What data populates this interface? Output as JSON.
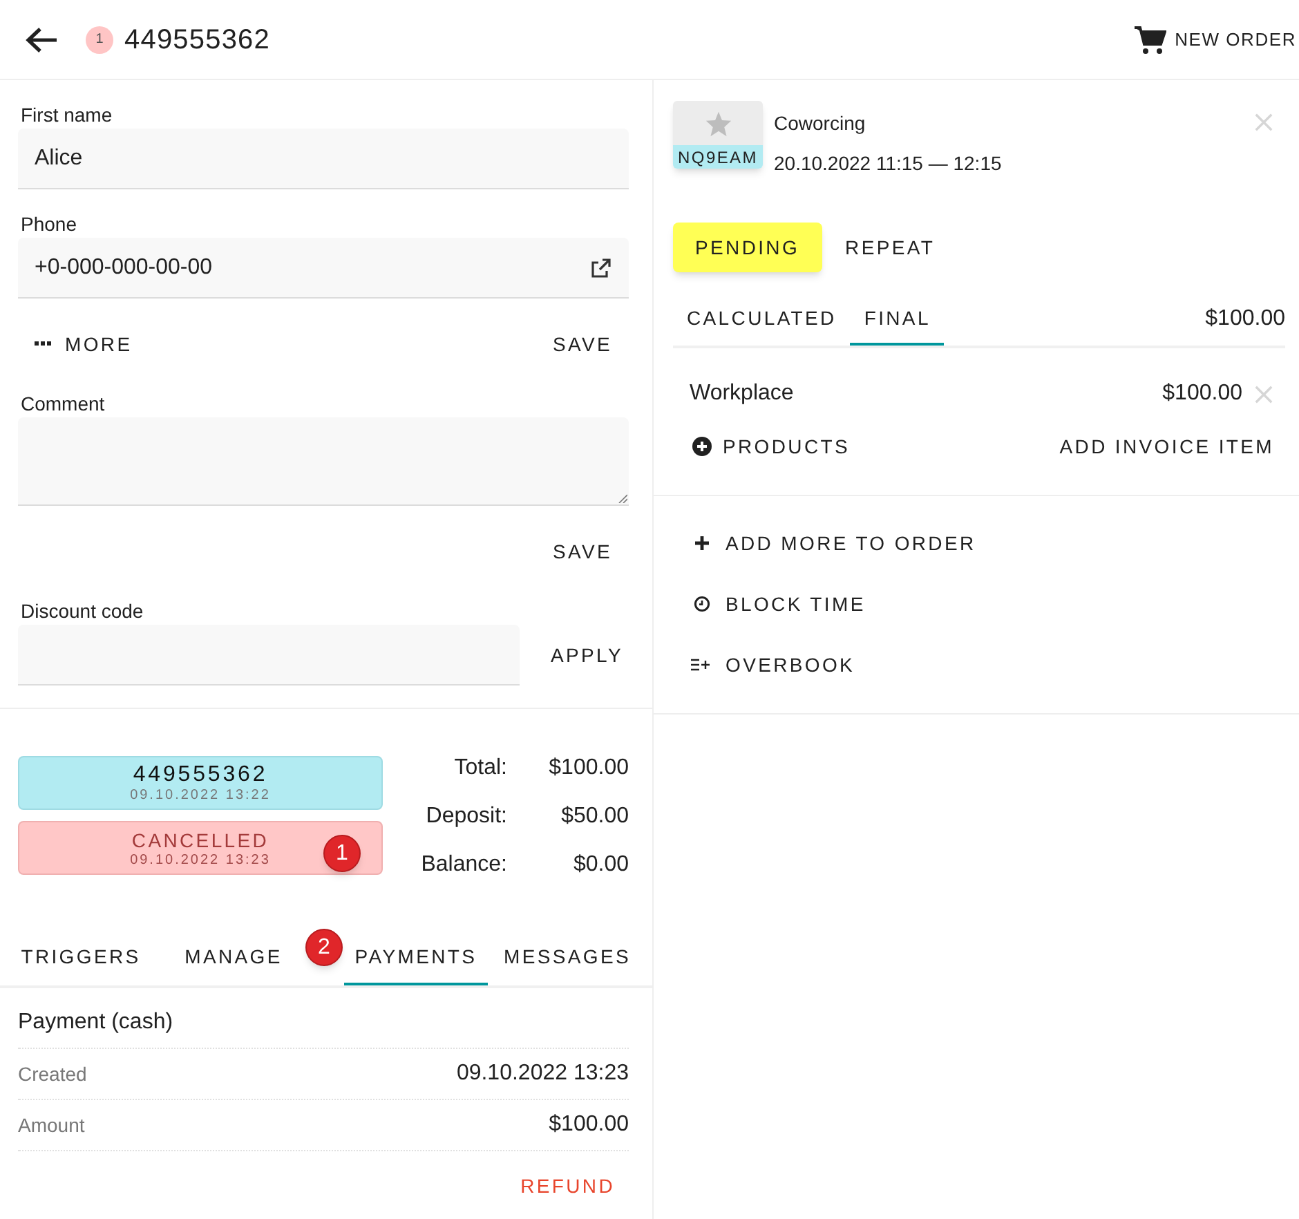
{
  "header": {
    "badge": "1",
    "title": "449555362",
    "new_order": "NEW ORDER"
  },
  "customer": {
    "first_name": {
      "label": "First name",
      "value": "Alice"
    },
    "phone": {
      "label": "Phone",
      "value": "+0-000-000-00-00"
    },
    "more": "MORE",
    "save": "SAVE"
  },
  "comment": {
    "label": "Comment",
    "save": "SAVE"
  },
  "discount": {
    "label": "Discount code",
    "apply": "APPLY"
  },
  "statuses": [
    {
      "kind": "order",
      "title": "449555362",
      "time": "09.10.2022 13:22"
    },
    {
      "kind": "cancelled",
      "title": "CANCELLED",
      "time": "09.10.2022 13:23"
    }
  ],
  "totals": [
    {
      "label": "Total:",
      "value": "$100.00"
    },
    {
      "label": "Deposit:",
      "value": "$50.00"
    },
    {
      "label": "Balance:",
      "value": "$0.00"
    }
  ],
  "tabs": [
    {
      "label": "TRIGGERS",
      "selected": false
    },
    {
      "label": "MANAGE",
      "selected": false
    },
    {
      "label": "PAYMENTS",
      "selected": true
    },
    {
      "label": "MESSAGES",
      "selected": false
    }
  ],
  "payment": {
    "title": "Payment (cash)",
    "rows": [
      {
        "label": "Created",
        "value": "09.10.2022 13:23"
      },
      {
        "label": "Amount",
        "value": "$100.00"
      }
    ],
    "refund": "REFUND"
  },
  "booking": {
    "code": "NQ9EAM",
    "title": "Coworcing",
    "time": "20.10.2022 11:15 — 12:15"
  },
  "status_buttons": [
    {
      "kind": "pending",
      "label": "PENDING"
    },
    {
      "kind": "plain",
      "label": "REPEAT"
    }
  ],
  "price_tabs": [
    {
      "label": "CALCULATED",
      "selected": false
    },
    {
      "label": "FINAL",
      "selected": true
    }
  ],
  "price_total": "$100.00",
  "items": [
    {
      "name": "Workplace",
      "price": "$100.00"
    }
  ],
  "products": "PRODUCTS",
  "add_invoice_item": "ADD INVOICE ITEM",
  "actions": [
    {
      "kind": "add",
      "label": "ADD MORE TO ORDER"
    },
    {
      "kind": "clock",
      "label": "BLOCK TIME"
    },
    {
      "kind": "overbook",
      "label": "OVERBOOK"
    }
  ],
  "callouts": [
    {
      "label": "1"
    },
    {
      "label": "2"
    }
  ]
}
